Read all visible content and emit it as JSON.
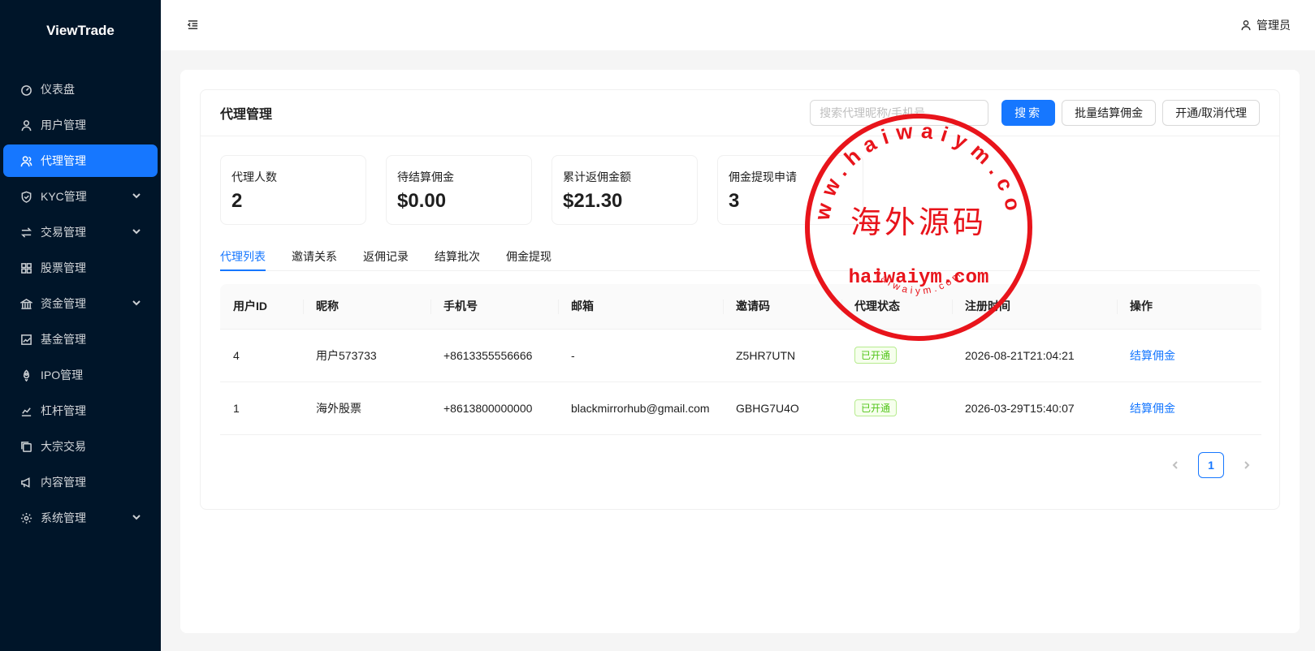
{
  "sidebar": {
    "brand": "ViewTrade",
    "items": [
      {
        "label": "仪表盘",
        "icon": "dashboard-icon"
      },
      {
        "label": "用户管理",
        "icon": "user-icon"
      },
      {
        "label": "代理管理",
        "icon": "agent-icon",
        "active": true
      },
      {
        "label": "KYC管理",
        "icon": "shield-icon",
        "expandable": true
      },
      {
        "label": "交易管理",
        "icon": "swap-icon",
        "expandable": true
      },
      {
        "label": "股票管理",
        "icon": "grid-icon"
      },
      {
        "label": "资金管理",
        "icon": "bank-icon",
        "expandable": true
      },
      {
        "label": "基金管理",
        "icon": "chart-icon"
      },
      {
        "label": "IPO管理",
        "icon": "rocket-icon"
      },
      {
        "label": "杠杆管理",
        "icon": "stock-icon"
      },
      {
        "label": "大宗交易",
        "icon": "copy-icon"
      },
      {
        "label": "内容管理",
        "icon": "megaphone-icon"
      },
      {
        "label": "系统管理",
        "icon": "gear-icon",
        "expandable": true
      }
    ]
  },
  "header": {
    "user": "管理员"
  },
  "card": {
    "title": "代理管理",
    "search_placeholder": "搜索代理昵称/手机号",
    "search_button": "搜索",
    "batch_button": "批量结算佣金",
    "toggle_button": "开通/取消代理"
  },
  "stats": [
    {
      "label": "代理人数",
      "value": "2"
    },
    {
      "label": "待结算佣金",
      "value": "$0.00"
    },
    {
      "label": "累计返佣金额",
      "value": "$21.30"
    },
    {
      "label": "佣金提现申请",
      "value": "3"
    }
  ],
  "tabs": [
    "代理列表",
    "邀请关系",
    "返佣记录",
    "结算批次",
    "佣金提现"
  ],
  "table": {
    "columns": [
      "用户ID",
      "昵称",
      "手机号",
      "邮箱",
      "邀请码",
      "代理状态",
      "注册时间",
      "操作"
    ],
    "rows": [
      {
        "id": "4",
        "nickname": "用户573733",
        "phone": "+8613355556666",
        "email": "-",
        "code": "Z5HR7UTN",
        "status": "已开通",
        "time": "2026-08-21T21:04:21",
        "action": "结算佣金"
      },
      {
        "id": "1",
        "nickname": "海外股票",
        "phone": "+8613800000000",
        "email": "blackmirrorhub@gmail.com",
        "code": "GBHG7U4O",
        "status": "已开通",
        "time": "2026-03-29T15:40:07",
        "action": "结算佣金"
      }
    ]
  },
  "pagination": {
    "current": "1"
  },
  "stamp": {
    "top_arc": "www.haiwaiym.com",
    "center": "海外源码",
    "domain": "haiwaiym.com",
    "bottom_arc": "haiwaiym.com",
    "color": "#e8141b"
  }
}
